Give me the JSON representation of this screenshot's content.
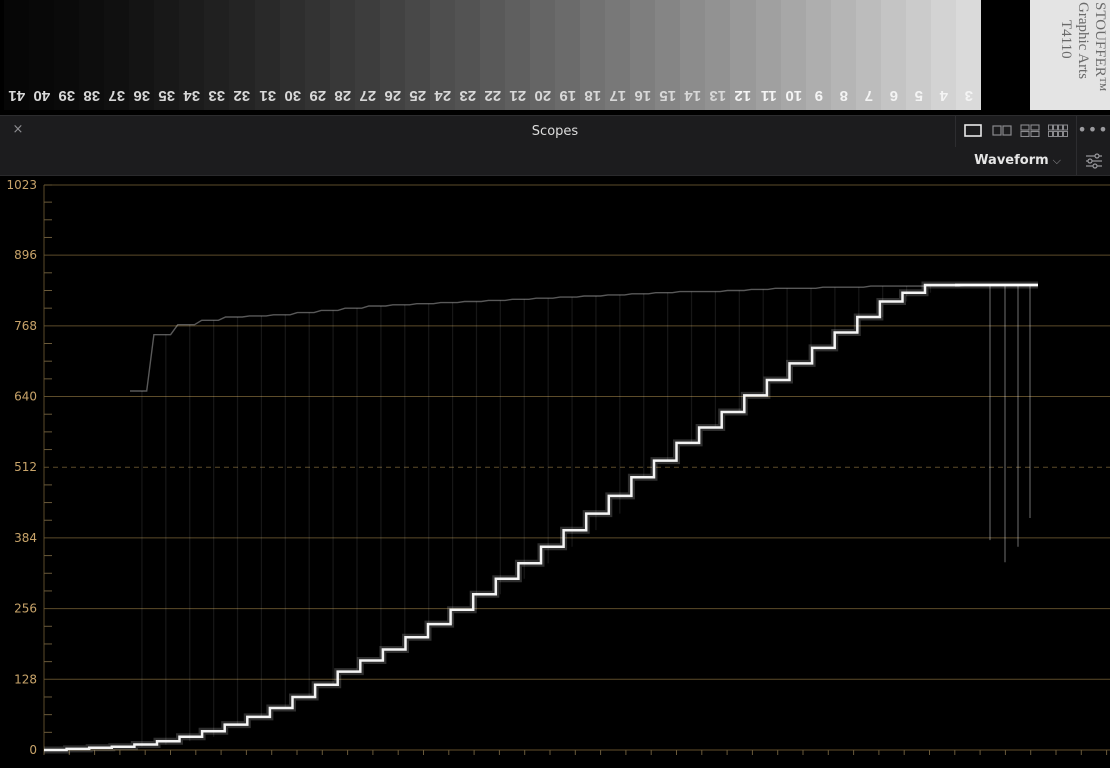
{
  "step_tablet": {
    "numbers": [
      "41",
      "40",
      "39",
      "38",
      "37",
      "36",
      "35",
      "34",
      "33",
      "32",
      "31",
      "30",
      "29",
      "28",
      "27",
      "26",
      "25",
      "24",
      "23",
      "22",
      "21",
      "20",
      "19",
      "18",
      "17",
      "16",
      "15",
      "14",
      "13",
      "12",
      "11",
      "10",
      "9",
      "8",
      "7",
      "6",
      "5",
      "4",
      "3"
    ],
    "brand_lines": [
      "STOUFFER™",
      "Graphic Arts",
      "T4110"
    ]
  },
  "panel": {
    "title": "Scopes",
    "close_glyph": "×",
    "more_glyph": "•••",
    "scope_type": "Waveform",
    "chevron_glyph": "⌵"
  },
  "icons": {
    "close": "close-icon",
    "single_view": "single-layout-icon",
    "dual_view": "dual-layout-icon",
    "quad_view": "quad-layout-icon",
    "multi_view": "multi-layout-icon",
    "more": "more-options-icon",
    "settings": "settings-sliders-icon"
  },
  "colors": {
    "panel_bg": "#1c1c1e",
    "scope_bg": "#000000",
    "graticule": "#6e5a32",
    "axis_label": "#c8a46a",
    "trace": "#ffffff"
  },
  "chart_data": {
    "type": "line",
    "title": "",
    "xlabel": "",
    "ylabel": "",
    "ylim": [
      0,
      1023
    ],
    "yticks": [
      0,
      128,
      256,
      384,
      512,
      640,
      768,
      896,
      1023
    ],
    "dashed_reference": 512,
    "grid": true,
    "series": [
      {
        "values": [
          0,
          2,
          4,
          6,
          10,
          16,
          24,
          34,
          46,
          60,
          76,
          96,
          118,
          142,
          162,
          182,
          204,
          228,
          254,
          282,
          310,
          338,
          368,
          398,
          428,
          460,
          494,
          524,
          556,
          584,
          612,
          642,
          670,
          700,
          728,
          756,
          784,
          812,
          828,
          842,
          842,
          842,
          842,
          842
        ]
      },
      {
        "values": [
          650,
          752,
          770,
          778,
          784,
          786,
          788,
          792,
          796,
          800,
          804,
          806,
          808,
          810,
          812,
          814,
          816,
          818,
          820,
          822,
          824,
          826,
          828,
          830,
          830,
          832,
          834,
          836,
          836,
          838,
          838,
          840,
          840,
          840,
          840,
          842,
          842,
          842
        ]
      }
    ]
  }
}
